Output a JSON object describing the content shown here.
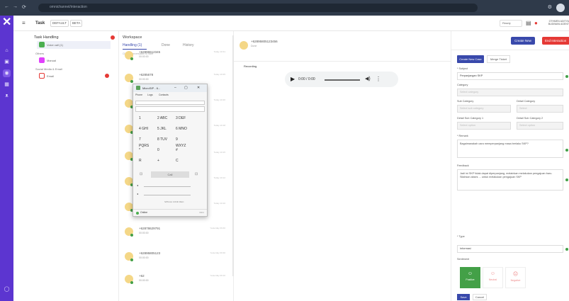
{
  "browser": {
    "url": "omnichannel/interaction",
    "nav": [
      "←",
      "→",
      "⟳"
    ]
  },
  "header": {
    "title": "Task",
    "badge1": "DEFAULT",
    "badge2": "BETA",
    "status": "Ready",
    "user": "OTHMEN ADITYA BUDIWAN AGENT"
  },
  "left_rail": {
    "icons": [
      "home-icon",
      "inbox-icon",
      "chat-icon",
      "grid-icon",
      "people-icon",
      "circle-icon"
    ]
  },
  "col1": {
    "title": "Task Handling",
    "item1": "Voice call (1)",
    "section1": "Others",
    "item2": "Manual",
    "section2": "Social Media & Email",
    "item3": "Email"
  },
  "workspace": {
    "title": "Workspace",
    "tabs": [
      "Handling (1)",
      "Done",
      "History"
    ],
    "hint": "Click a conversation to start",
    "conversations": [
      {
        "num": "+62896512345",
        "time": "00:00:00",
        "sub": "",
        "when": "Today 10:31"
      },
      {
        "num": "+6285678",
        "time": "00:00:00",
        "sub": "",
        "when": "Today 10:25"
      },
      {
        "num": "+6281234",
        "time": "00:00:00",
        "sub": "",
        "when": "Today 10:20"
      },
      {
        "num": "+6287777",
        "time": "00:00:00",
        "sub": "",
        "when": "Today 10:18"
      },
      {
        "num": "+6281111",
        "time": "00:00:00",
        "sub": "",
        "when": "Today 10:15"
      },
      {
        "num": "+6282222",
        "time": "00:00:00",
        "sub": "",
        "when": "Today 10:12"
      },
      {
        "num": "+6283333",
        "time": "00:00:00",
        "sub": "",
        "when": "Today 10:10"
      },
      {
        "num": "+62878629791",
        "time": "00:00:00",
        "sub": "",
        "when": "Yesterday 09:40"
      },
      {
        "num": "+62895805123",
        "time": "00:00:00",
        "sub": "",
        "when": "Yesterday 09:30"
      },
      {
        "num": "+62",
        "time": "00:00:00",
        "sub": "",
        "when": "Yesterday 09:10"
      }
    ]
  },
  "phone": {
    "title": "MicroSIP - 6...",
    "menu": [
      "Phone",
      "Logs",
      "Contacts"
    ],
    "keys": [
      [
        "1",
        "2 ABC",
        "3 DEF"
      ],
      [
        "4 GHI",
        "5 JKL",
        "6 MNO"
      ],
      [
        "7 PQRS",
        "8 TUV",
        "9 WXYZ"
      ],
      [
        "*",
        "0",
        "#"
      ],
      [
        "R",
        "+",
        "C"
      ]
    ],
    "call": "Call",
    "status": "Online",
    "acct": "6001",
    "options": "SPM  AA  CONF  REC"
  },
  "detail": {
    "num": "+62895805123456",
    "state": "Done",
    "recording_label": "Recording",
    "audio_time": "0:00 / 0:00"
  },
  "case": {
    "create_btn": "Create New",
    "end_btn": "End Interaction",
    "tab_new": "Create New Case",
    "tab_merge": "Merge Ticket",
    "subject_label": "* Subject",
    "subject_value": "Perpanjangan SKP",
    "category_label": "Category",
    "category_value": "Select category",
    "subcat_label": "Sub Category",
    "detail_cat_label": "Detail Category",
    "subcat_value": "Select sub category",
    "detail_cat_value": "Select",
    "dsub1_label": "Detail Sub Category 1",
    "dsub2_label": "Detail Sub Category 2",
    "dsub1_value": "Select option",
    "dsub2_value": "Select option",
    "remark_label": "* Remark",
    "remark_value": "Bagaimanakah cara memperpanjang masa berlaku SKP?",
    "feedback_label": "Feedback",
    "feedback_value": "Jadi ini SKP tidak dapat diperpanjang, melainkan melakukan pengajuan baru. Silahkan akses ... untuk melakukan pengajuan SKP",
    "type_label": "* Type",
    "type_value": "Informasi",
    "sentiment_label": "Sentiment",
    "sentiments": [
      "Positive",
      "Neutral",
      "Negative"
    ],
    "save": "Save",
    "cancel": "Cancel"
  }
}
